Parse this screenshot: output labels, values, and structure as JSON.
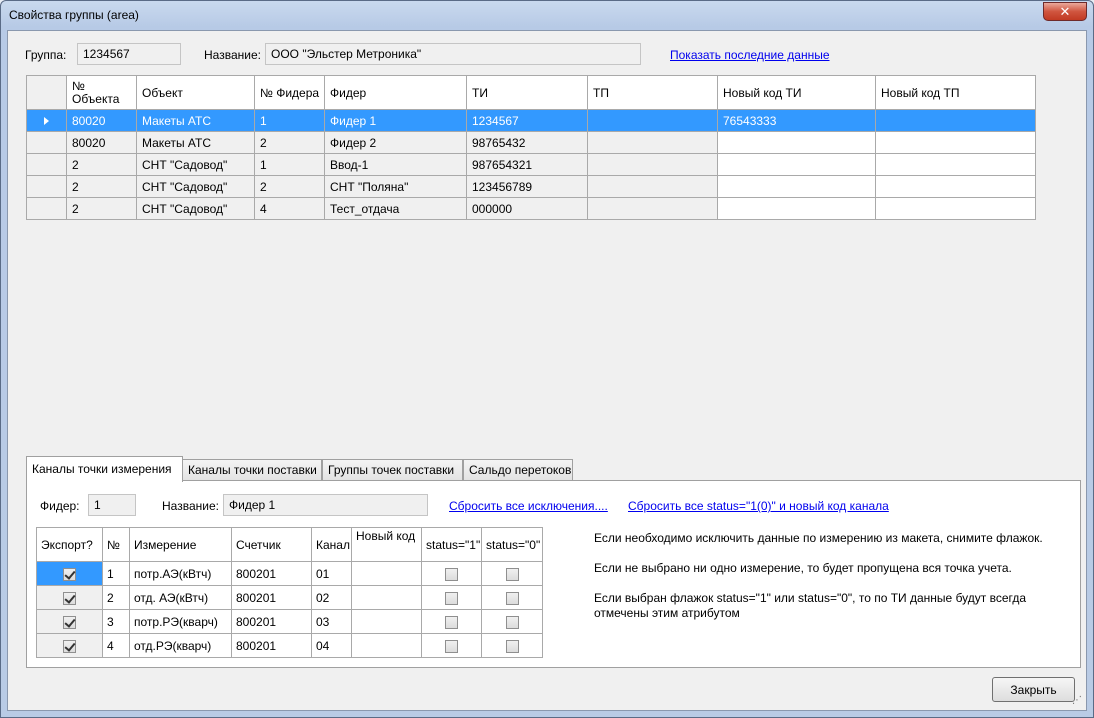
{
  "window": {
    "title": "Свойства группы (area)",
    "close_glyph": "✕"
  },
  "header": {
    "group_label": "Группа:",
    "group_value": "1234567",
    "name_label": "Название:",
    "name_value": "ООО \"Эльстер Метроника\"",
    "show_last_link": "Показать последние данные"
  },
  "main_grid": {
    "columns": [
      "№ Объекта",
      "Объект",
      "№ Фидера",
      "Фидер",
      "ТИ",
      "ТП",
      "Новый код ТИ",
      "Новый код ТП"
    ],
    "rows": [
      {
        "obj_no": "80020",
        "object": "Макеты АТС",
        "feeder_no": "1",
        "feeder": "Фидер 1",
        "ti": "1234567",
        "tp": "",
        "new_ti": "76543333",
        "new_tp": ""
      },
      {
        "obj_no": "80020",
        "object": "Макеты АТС",
        "feeder_no": "2",
        "feeder": "Фидер 2",
        "ti": "98765432",
        "tp": "",
        "new_ti": "",
        "new_tp": ""
      },
      {
        "obj_no": "2",
        "object": "СНТ \"Садовод\"",
        "feeder_no": "1",
        "feeder": "Ввод-1",
        "ti": "987654321",
        "tp": "",
        "new_ti": "",
        "new_tp": ""
      },
      {
        "obj_no": "2",
        "object": "СНТ \"Садовод\"",
        "feeder_no": "2",
        "feeder": "СНТ \"Поляна\"",
        "ti": "123456789",
        "tp": "",
        "new_ti": "",
        "new_tp": ""
      },
      {
        "obj_no": "2",
        "object": "СНТ \"Садовод\"",
        "feeder_no": "4",
        "feeder": "Тест_отдача",
        "ti": "000000",
        "tp": "",
        "new_ti": "",
        "new_tp": ""
      }
    ]
  },
  "tabs": [
    {
      "label": "Каналы точки измерения",
      "active": true
    },
    {
      "label": "Каналы точки поставки",
      "active": false
    },
    {
      "label": "Группы точек поставки",
      "active": false
    },
    {
      "label": "Сальдо перетоков",
      "active": false
    }
  ],
  "panel": {
    "feeder_label": "Фидер:",
    "feeder_value": "1",
    "name_label": "Название:",
    "name_value": "Фидер 1",
    "reset_exclusions_link": "Сбросить все исключения....",
    "reset_status_link": "Сбросить все status=\"1(0)\" и новый код канала",
    "channels": {
      "columns": [
        "Экспорт?",
        "№",
        "Измерение",
        "Счетчик",
        "Канал",
        "Новый код",
        "status=\"1\"",
        "status=\"0\""
      ],
      "rows": [
        {
          "export": true,
          "no": "1",
          "measure": "потр.АЭ(кВтч)",
          "meter": "800201",
          "channel": "01",
          "new_code": "",
          "s1": false,
          "s0": false
        },
        {
          "export": true,
          "no": "2",
          "measure": "отд. АЭ(кВтч)",
          "meter": "800201",
          "channel": "02",
          "new_code": "",
          "s1": false,
          "s0": false
        },
        {
          "export": true,
          "no": "3",
          "measure": "потр.РЭ(кварч)",
          "meter": "800201",
          "channel": "03",
          "new_code": "",
          "s1": false,
          "s0": false
        },
        {
          "export": true,
          "no": "4",
          "measure": "отд.РЭ(кварч)",
          "meter": "800201",
          "channel": "04",
          "new_code": "",
          "s1": false,
          "s0": false
        }
      ]
    },
    "hints": [
      "Если необходимо исключить данные по измерению из макета, снимите флажок.",
      "Если не выбрано ни одно измерение, то будет пропущена вся точка учета.",
      "Если выбран флажок status=\"1\" или status=\"0\", то по ТИ данные будут всегда отмечены этим атрибутом"
    ]
  },
  "footer": {
    "close_button": "Закрыть"
  },
  "colors": {
    "selection": "#3399ff",
    "link": "#0000ee",
    "close": "#c13a23"
  }
}
